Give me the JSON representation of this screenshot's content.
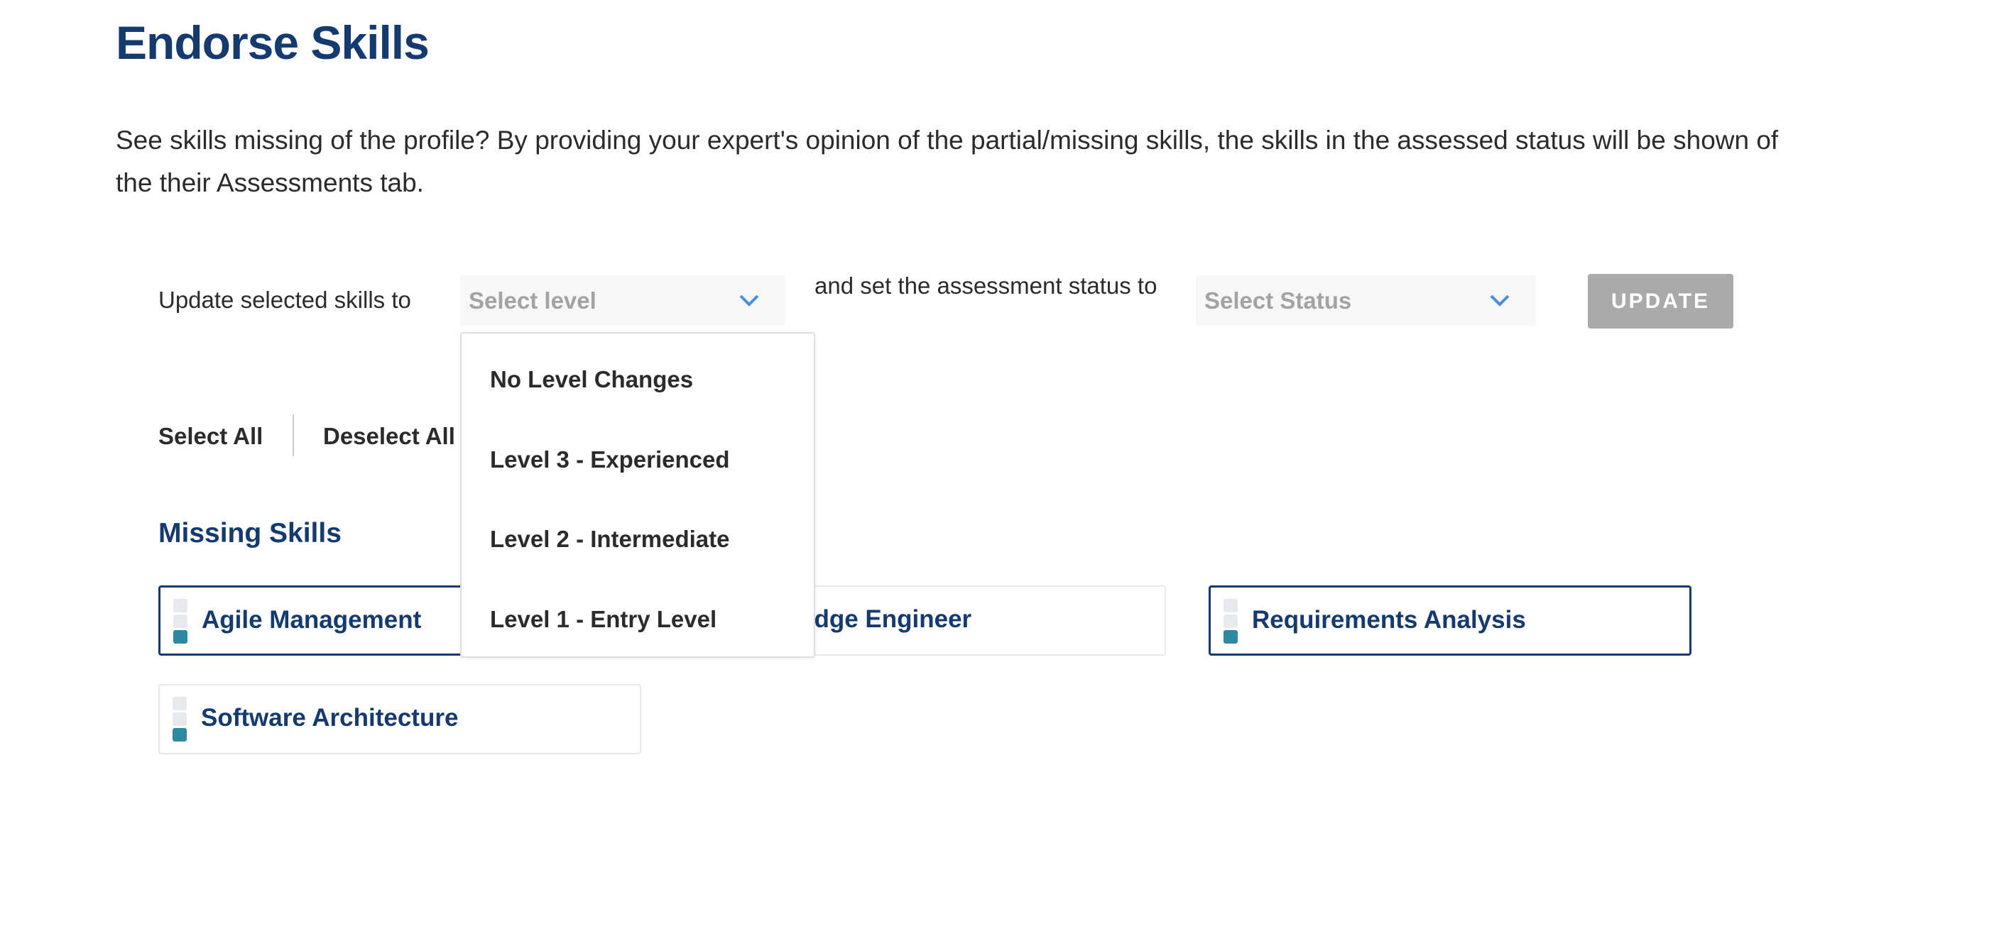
{
  "header": {
    "title": "Endorse Skills",
    "description": "See skills missing of the profile? By providing your expert's opinion of the partial/missing skills, the skills in the assessed status will be shown of the their Assessments tab."
  },
  "toolbar": {
    "update_label": "Update selected skills to",
    "level_select": {
      "placeholder": "Select level",
      "open": true
    },
    "status_label": "and set the assessment status to",
    "status_select": {
      "placeholder": "Select Status"
    },
    "update_button": "UPDATE",
    "select_all": "Select All",
    "deselect_all": "Deselect All"
  },
  "level_options": [
    "No Level Changes",
    "Level 3 - Experienced",
    "Level 2 - Intermediate",
    "Level 1 - Entry Level"
  ],
  "missing_skills": {
    "heading": "Missing Skills",
    "items": [
      {
        "name": "Agile Management",
        "selected": true,
        "level": 1
      },
      {
        "name": "Knowledge Engineer",
        "selected": false,
        "level": 1
      },
      {
        "name": "Requirements Analysis",
        "selected": true,
        "level": 1
      },
      {
        "name": "Software Architecture",
        "selected": false,
        "level": 1
      }
    ]
  },
  "colors": {
    "primary": "#143a6f",
    "level_fill": "#2e89a3",
    "chevron": "#4a90e2",
    "button_disabled": "#aaaaaa"
  }
}
